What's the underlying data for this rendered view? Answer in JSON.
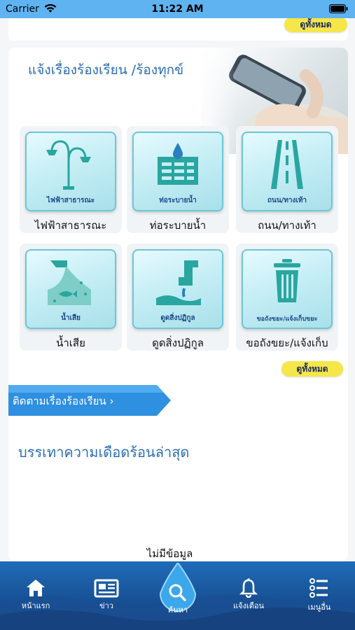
{
  "status_bar": {
    "carrier": "Carrier",
    "time": "11:22 AM"
  },
  "top_section": {
    "see_all_label": "ดูทั้งหมด"
  },
  "complaint_section": {
    "title": "แจ้งเรื่องร้องเรียน /ร้องทุกข์",
    "tiles": [
      {
        "icon": "street-lamp-icon",
        "caption": "ไฟฟ้าสาธารณะ",
        "label": "ไฟฟ้าสาธารณะ"
      },
      {
        "icon": "drain-icon",
        "caption": "ท่อระบายน้ำ",
        "label": "ท่อระบายน้ำ"
      },
      {
        "icon": "road-icon",
        "caption": "ถนน/ทางเท้า",
        "label": "ถนน/ทางเท้า"
      },
      {
        "icon": "wastewater-icon",
        "caption": "น้ำเสีย",
        "label": "น้ำเสีย"
      },
      {
        "icon": "sewage-pipe-icon",
        "caption": "ดูดสิ่งปฏิกูล",
        "label": "ดูดสิ่งปฏิกูล"
      },
      {
        "icon": "trash-bin-icon",
        "caption": "ขอถังขยะ/แจ้งเก็บขยะ",
        "label": "ขอถังขยะ/แจ้งเก็บ"
      }
    ],
    "see_all_label": "ดูทั้งหมด"
  },
  "follow_banner": {
    "label": "ติดตามเรื่องร้องเรียน",
    "icon": "chevron-right-icon"
  },
  "news": {
    "title": "บรรเทาความเดือดร้อนล่าสุด",
    "empty_text": "ไม่มีข้อมูล"
  },
  "tab_bar": {
    "tabs": [
      {
        "label": "หน้าแรก",
        "icon": "home-icon"
      },
      {
        "label": "ข่าว",
        "icon": "newspaper-icon"
      },
      {
        "label": "ค้นหา",
        "icon": "search-icon"
      },
      {
        "label": "แจ้งเตือน",
        "icon": "bell-icon"
      },
      {
        "label": "เมนูอื่น",
        "icon": "menu-list-icon"
      }
    ]
  },
  "colors": {
    "status_bar": "#5fb3f0",
    "accent_blue": "#2b6fb5",
    "pill_yellow": "#f5e64a",
    "banner_blue": "#4aa9ee",
    "tab_bar": "#1a5aa2"
  }
}
